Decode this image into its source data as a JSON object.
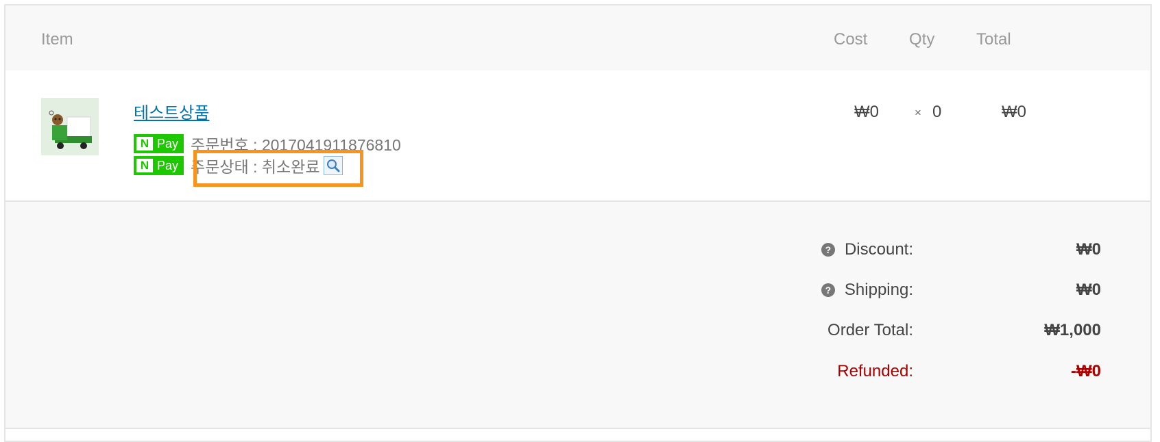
{
  "table": {
    "headers": {
      "item": "Item",
      "cost": "Cost",
      "qty": "Qty",
      "total": "Total"
    },
    "rows": [
      {
        "product_name": "테스트상품",
        "npay_badge": {
          "n": "N",
          "pay": "Pay"
        },
        "order_number": "주문번호 : 2017041911876810",
        "order_status": "주문상태 : 취소완료",
        "cost": "₩0",
        "times": "×",
        "qty": "0",
        "total": "₩0"
      }
    ]
  },
  "totals": {
    "discount_label": "Discount:",
    "discount_value": "₩0",
    "shipping_label": "Shipping:",
    "shipping_value": "₩0",
    "order_total_label": "Order Total:",
    "order_total_value": "₩1,000",
    "refunded_label": "Refunded:",
    "refunded_value": "-₩0",
    "help_glyph": "?"
  },
  "colors": {
    "link": "#0073aa",
    "npay_green": "#1ec800",
    "highlight_orange": "#f7941d",
    "refund_red": "#aa0000"
  },
  "icons": {
    "status_lookup": "magnifier-icon",
    "help": "help-icon",
    "product_thumbnail": "truck-icon"
  }
}
